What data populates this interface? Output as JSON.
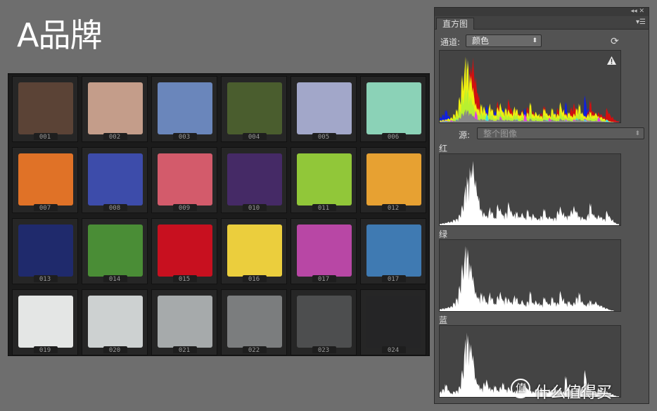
{
  "brand_title": "A品牌",
  "checker": {
    "patches": [
      {
        "num": "001",
        "color": "#5b4336"
      },
      {
        "num": "002",
        "color": "#c49d8a"
      },
      {
        "num": "003",
        "color": "#6a86bb"
      },
      {
        "num": "004",
        "color": "#4a5d2e"
      },
      {
        "num": "005",
        "color": "#a2a7c9"
      },
      {
        "num": "006",
        "color": "#8bd2b7"
      },
      {
        "num": "007",
        "color": "#e07227"
      },
      {
        "num": "008",
        "color": "#3d4caa"
      },
      {
        "num": "009",
        "color": "#d35b6b"
      },
      {
        "num": "010",
        "color": "#452a66"
      },
      {
        "num": "011",
        "color": "#91c739"
      },
      {
        "num": "012",
        "color": "#e7a132"
      },
      {
        "num": "013",
        "color": "#1f2a6c"
      },
      {
        "num": "014",
        "color": "#4a8d36"
      },
      {
        "num": "015",
        "color": "#c8101f"
      },
      {
        "num": "016",
        "color": "#ebce3d"
      },
      {
        "num": "017",
        "color": "#b847a5"
      },
      {
        "num": "017",
        "color": "#3f7ab2"
      },
      {
        "num": "019",
        "color": "#e4e6e5"
      },
      {
        "num": "020",
        "color": "#cdd1d1"
      },
      {
        "num": "021",
        "color": "#a6aaab"
      },
      {
        "num": "022",
        "color": "#7b7d7e"
      },
      {
        "num": "023",
        "color": "#4d4e4f"
      },
      {
        "num": "024",
        "color": "#252526"
      }
    ]
  },
  "panel": {
    "tab_label": "直方图",
    "collapse_icon": "double-chevron-icon",
    "channel_label": "通道:",
    "channel_value": "颜色",
    "source_label": "源:",
    "source_value": "整个图像",
    "red_label": "红",
    "green_label": "绿",
    "blue_label": "蓝"
  },
  "watermark": "什么值得买",
  "histograms": {
    "colors": {
      "red": "#d01010",
      "green": "#b8f030",
      "blue": "#1020e0",
      "cyan": "#40e0e0",
      "magenta": "#e040e0",
      "yellow": "#f0f010",
      "white": "#ffffff"
    },
    "red_levels": [
      2,
      3,
      4,
      5,
      6,
      8,
      10,
      15,
      30,
      55,
      70,
      90,
      92,
      70,
      40,
      25,
      18,
      15,
      25,
      20,
      12,
      30,
      26,
      15,
      20,
      32,
      22,
      16,
      20,
      14,
      18,
      12,
      22,
      14,
      16,
      12,
      10,
      14,
      26,
      12,
      14,
      10,
      12,
      20,
      28,
      18,
      14,
      16,
      22,
      30,
      20,
      14,
      12,
      10,
      16,
      32,
      18,
      12,
      16,
      12,
      10,
      20,
      14,
      8,
      4,
      2
    ],
    "green_levels": [
      3,
      4,
      5,
      6,
      8,
      12,
      20,
      35,
      70,
      90,
      92,
      75,
      50,
      30,
      20,
      28,
      22,
      14,
      26,
      20,
      12,
      22,
      30,
      16,
      22,
      18,
      14,
      22,
      20,
      12,
      16,
      10,
      14,
      30,
      12,
      16,
      12,
      10,
      22,
      14,
      12,
      20,
      14,
      12,
      30,
      18,
      12,
      16,
      10,
      14,
      20,
      28,
      14,
      10,
      12,
      16,
      12,
      14,
      10,
      8,
      6,
      4,
      2,
      1,
      0,
      0
    ],
    "blue_levels": [
      8,
      12,
      20,
      10,
      6,
      8,
      10,
      15,
      40,
      80,
      92,
      85,
      60,
      30,
      18,
      14,
      20,
      26,
      14,
      12,
      18,
      10,
      16,
      20,
      12,
      14,
      10,
      8,
      10,
      12,
      14,
      22,
      12,
      10,
      8,
      12,
      10,
      14,
      10,
      8,
      12,
      10,
      16,
      10,
      12,
      8,
      30,
      14,
      10,
      8,
      12,
      18,
      14,
      40,
      20,
      12,
      10,
      8,
      14,
      12,
      10,
      8,
      6,
      4,
      2,
      1
    ]
  }
}
